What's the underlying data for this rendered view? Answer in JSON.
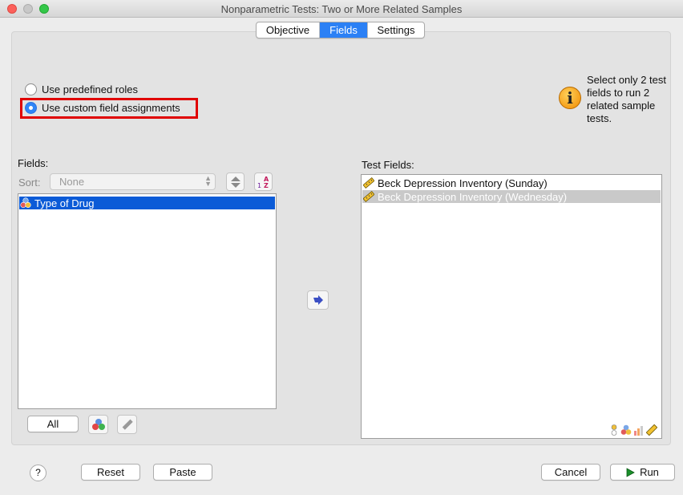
{
  "window": {
    "title": "Nonparametric Tests: Two or More Related Samples"
  },
  "tabs": [
    {
      "label": "Objective",
      "active": false
    },
    {
      "label": "Fields",
      "active": true
    },
    {
      "label": "Settings",
      "active": false
    }
  ],
  "roles": {
    "option_predefined": "Use predefined roles",
    "option_custom": "Use custom field assignments",
    "selected": "custom"
  },
  "info": {
    "text": "Select only 2 test fields to run 2 related sample tests."
  },
  "fields_panel": {
    "label": "Fields:",
    "sort_label": "Sort:",
    "sort_value": "None",
    "items": [
      {
        "label": "Type of Drug",
        "icon": "nominal-icon",
        "selected": true
      }
    ],
    "all_button": "All"
  },
  "test_fields_panel": {
    "label": "Test Fields:",
    "items": [
      {
        "label": "Beck Depression Inventory (Sunday)",
        "icon": "scale-ruler-icon",
        "selected": false
      },
      {
        "label": "Beck Depression Inventory (Wednesday)",
        "icon": "scale-ruler-icon",
        "selected": true
      }
    ]
  },
  "footer": {
    "help_label": "?",
    "reset_label": "Reset",
    "paste_label": "Paste",
    "cancel_label": "Cancel",
    "run_label": "Run"
  },
  "colors": {
    "accent": "#2b80f5",
    "selection": "#0b5bd7",
    "highlight_border": "#e00000",
    "info_icon": "#f5a300"
  }
}
